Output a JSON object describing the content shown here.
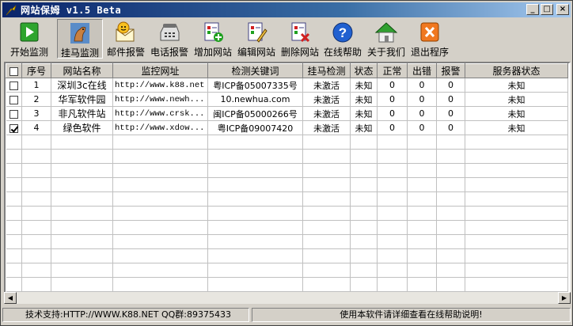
{
  "window": {
    "title": "网站保姆 v1.5 Beta",
    "controls": {
      "minimize": "_",
      "maximize": "□",
      "close": "×"
    }
  },
  "toolbar": [
    {
      "label": "开始监测",
      "icon": "play-icon"
    },
    {
      "label": "挂马监测",
      "icon": "horse-icon",
      "pressed": true
    },
    {
      "label": "邮件报警",
      "icon": "mail-alarm-icon"
    },
    {
      "label": "电话报警",
      "icon": "phone-icon"
    },
    {
      "label": "增加网站",
      "icon": "add-site-icon"
    },
    {
      "label": "编辑网站",
      "icon": "edit-site-icon"
    },
    {
      "label": "删除网站",
      "icon": "delete-site-icon"
    },
    {
      "label": "在线帮助",
      "icon": "help-icon"
    },
    {
      "label": "关于我们",
      "icon": "home-icon"
    },
    {
      "label": "退出程序",
      "icon": "exit-icon"
    }
  ],
  "table": {
    "columns": [
      "",
      "序号",
      "网站名称",
      "监控网址",
      "检测关键词",
      "挂马检测",
      "状态",
      "正常",
      "出错",
      "报警",
      "服务器状态"
    ],
    "rows": [
      {
        "checked": false,
        "no": "1",
        "name": "深圳3c在线",
        "url": "http://www.k88.net",
        "keyword": "粤ICP备05007335号",
        "trojan": "未激活",
        "state": "未知",
        "ok": "0",
        "err": "0",
        "alarm": "0",
        "server": "未知"
      },
      {
        "checked": false,
        "no": "2",
        "name": "华军软件园",
        "url": "http://www.newh...",
        "keyword": "10.newhua.com",
        "trojan": "未激活",
        "state": "未知",
        "ok": "0",
        "err": "0",
        "alarm": "0",
        "server": "未知"
      },
      {
        "checked": false,
        "no": "3",
        "name": "非凡软件站",
        "url": "http://www.crsk...",
        "keyword": "闽ICP备05000266号",
        "trojan": "未激活",
        "state": "未知",
        "ok": "0",
        "err": "0",
        "alarm": "0",
        "server": "未知"
      },
      {
        "checked": true,
        "no": "4",
        "name": "绿色软件",
        "url": "http://www.xdow...",
        "keyword": "粤ICP备09007420",
        "trojan": "未激活",
        "state": "未知",
        "ok": "0",
        "err": "0",
        "alarm": "0",
        "server": "未知"
      }
    ]
  },
  "scrollbar": {
    "left": "◀",
    "right": "▶"
  },
  "status": {
    "support": "技术支持:HTTP://WWW.K88.NET  QQ群:89375433",
    "hint": "使用本软件请详细查看在线帮助说明!"
  },
  "colors": {
    "titlebar_start": "#0a246a",
    "titlebar_end": "#a6caf0",
    "window_bg": "#d4d0c8"
  }
}
